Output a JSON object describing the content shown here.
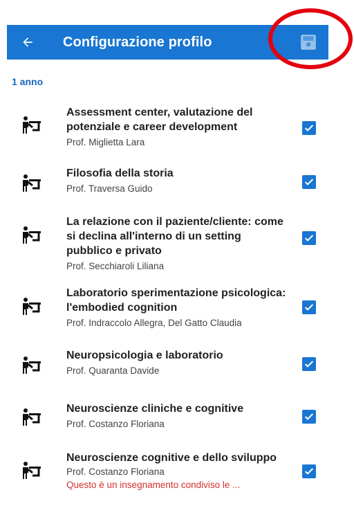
{
  "header": {
    "title": "Configurazione profilo"
  },
  "section": {
    "label": "1 anno"
  },
  "courses": [
    {
      "name": "Assessment center, valutazione del potenziale e career development",
      "prof": "Prof. Miglietta Lara",
      "checked": true
    },
    {
      "name": "Filosofia della storia",
      "prof": "Prof. Traversa Guido",
      "checked": true
    },
    {
      "name": "La relazione con il paziente/cliente: come si declina all'interno di un setting pubblico e privato",
      "prof": "Prof. Secchiaroli Liliana",
      "checked": true
    },
    {
      "name": "Laboratorio sperimentazione psicologica: l'embodied cognition",
      "prof": "Prof. Indraccolo Allegra, Del Gatto Claudia",
      "checked": true
    },
    {
      "name": "Neuropsicologia e laboratorio",
      "prof": "Prof. Quaranta Davide",
      "checked": true
    },
    {
      "name": "Neuroscienze cliniche e cognitive",
      "prof": "Prof. Costanzo Floriana",
      "checked": true
    },
    {
      "name": "Neuroscienze cognitive e dello sviluppo",
      "prof": "Prof. Costanzo Floriana",
      "checked": true,
      "note": "Questo è un insegnamento condiviso le ..."
    }
  ],
  "colors": {
    "accent": "#1976d2",
    "section": "#1565c0",
    "highlight": "#e3000f",
    "note": "#d32f2f"
  },
  "icons": {
    "back": "arrow-left-icon",
    "save": "floppy-disk-icon",
    "course": "teacher-board-icon",
    "check": "checkbox-checked-icon"
  }
}
